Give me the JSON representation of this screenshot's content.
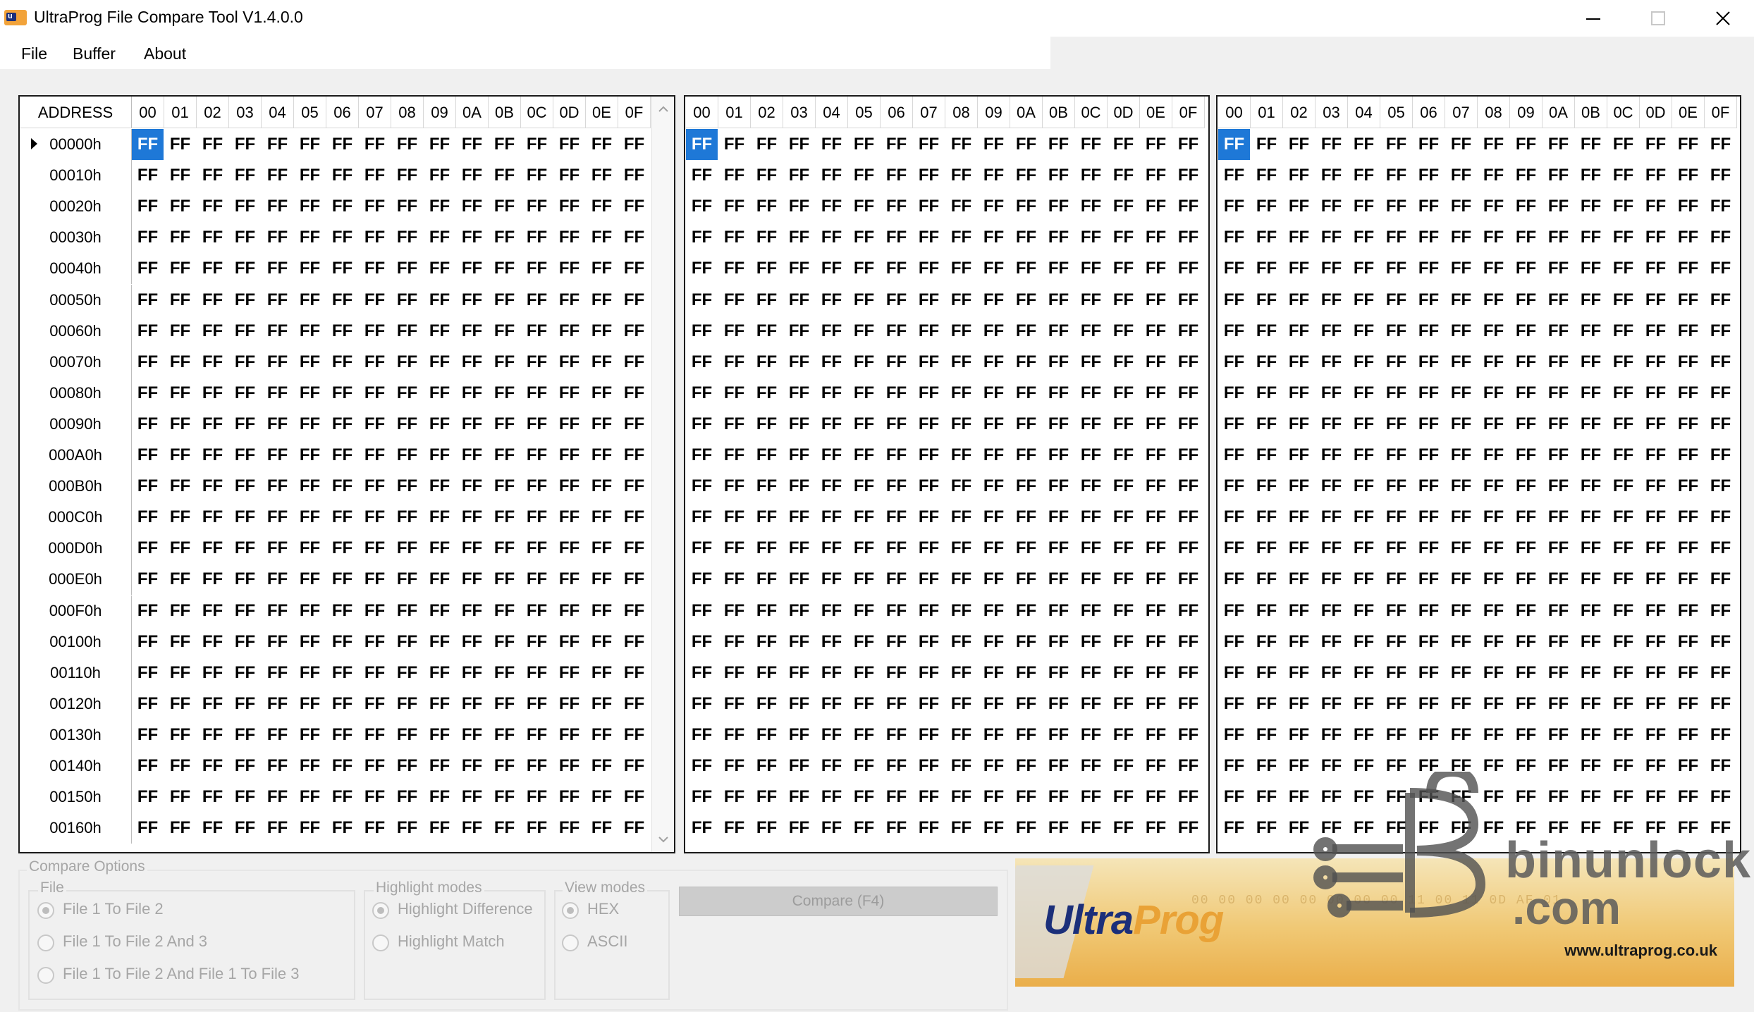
{
  "window": {
    "title": "UltraProg File Compare Tool V1.4.0.0",
    "icon": "ultraprog-app-icon"
  },
  "menu": [
    "File",
    "Buffer",
    "About"
  ],
  "grid": {
    "address_header": "ADDRESS",
    "columns": [
      "00",
      "01",
      "02",
      "03",
      "04",
      "05",
      "06",
      "07",
      "08",
      "09",
      "0A",
      "0B",
      "0C",
      "0D",
      "0E",
      "0F"
    ],
    "addresses": [
      "00000h",
      "00010h",
      "00020h",
      "00030h",
      "00040h",
      "00050h",
      "00060h",
      "00070h",
      "00080h",
      "00090h",
      "000A0h",
      "000B0h",
      "000C0h",
      "000D0h",
      "000E0h",
      "000F0h",
      "00100h",
      "00110h",
      "00120h",
      "00130h",
      "00140h",
      "00150h",
      "00160h"
    ],
    "cell_value": "FF",
    "selected_cell": {
      "row": 0,
      "col": 0
    },
    "selection_color": "#1e78d7"
  },
  "options": {
    "compare_options_label": "Compare Options",
    "file_group_label": "File",
    "file_options": [
      "File 1 To File 2",
      "File 1 To File 2 And 3",
      "File 1 To File 2 And File 1 To File 3"
    ],
    "file_selected": 0,
    "highlight_group_label": "Highlight modes",
    "highlight_options": [
      "Highlight Difference",
      "Highlight Match"
    ],
    "highlight_selected": 0,
    "view_group_label": "View modes",
    "view_options": [
      "HEX",
      "ASCII"
    ],
    "view_selected": 0,
    "compare_button": "Compare (F4)"
  },
  "banner": {
    "logo_part1": "Ultra",
    "logo_part2": "Prog",
    "url": "www.ultraprog.co.uk",
    "hex_bg": "00 00 00 00 00 00 00 00 11 00 11 0D AF 01"
  },
  "watermark": {
    "line1": "binunlock",
    "line2": ".com"
  }
}
